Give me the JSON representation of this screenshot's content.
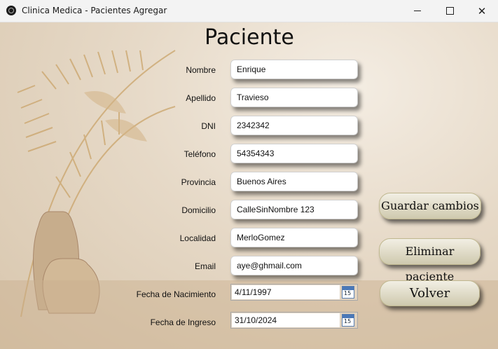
{
  "window": {
    "title": "Clinica Medica - Pacientes Agregar",
    "controls": {
      "minimize": "—",
      "maximize": "☐",
      "close": "✕"
    }
  },
  "heading": "Paciente",
  "fields": [
    {
      "label": "Nombre",
      "value": "Enrique"
    },
    {
      "label": "Apellido",
      "value": "Travieso"
    },
    {
      "label": "DNI",
      "value": "2342342"
    },
    {
      "label": "Teléfono",
      "value": "54354343"
    },
    {
      "label": "Provincia",
      "value": "Buenos Aires"
    },
    {
      "label": "Domicilio",
      "value": "CalleSinNombre 123"
    },
    {
      "label": "Localidad",
      "value": "MerloGomez"
    },
    {
      "label": "Email",
      "value": "aye@ghmail.com"
    }
  ],
  "dates": [
    {
      "label": "Fecha de Nacimiento",
      "value": "4/11/1997",
      "calendar_day": "15"
    },
    {
      "label": "Fecha de Ingreso",
      "value": "31/10/2024",
      "calendar_day": "15"
    }
  ],
  "buttons": {
    "save": "Guardar cambios",
    "delete": "Eliminar paciente",
    "back": "Volver"
  }
}
